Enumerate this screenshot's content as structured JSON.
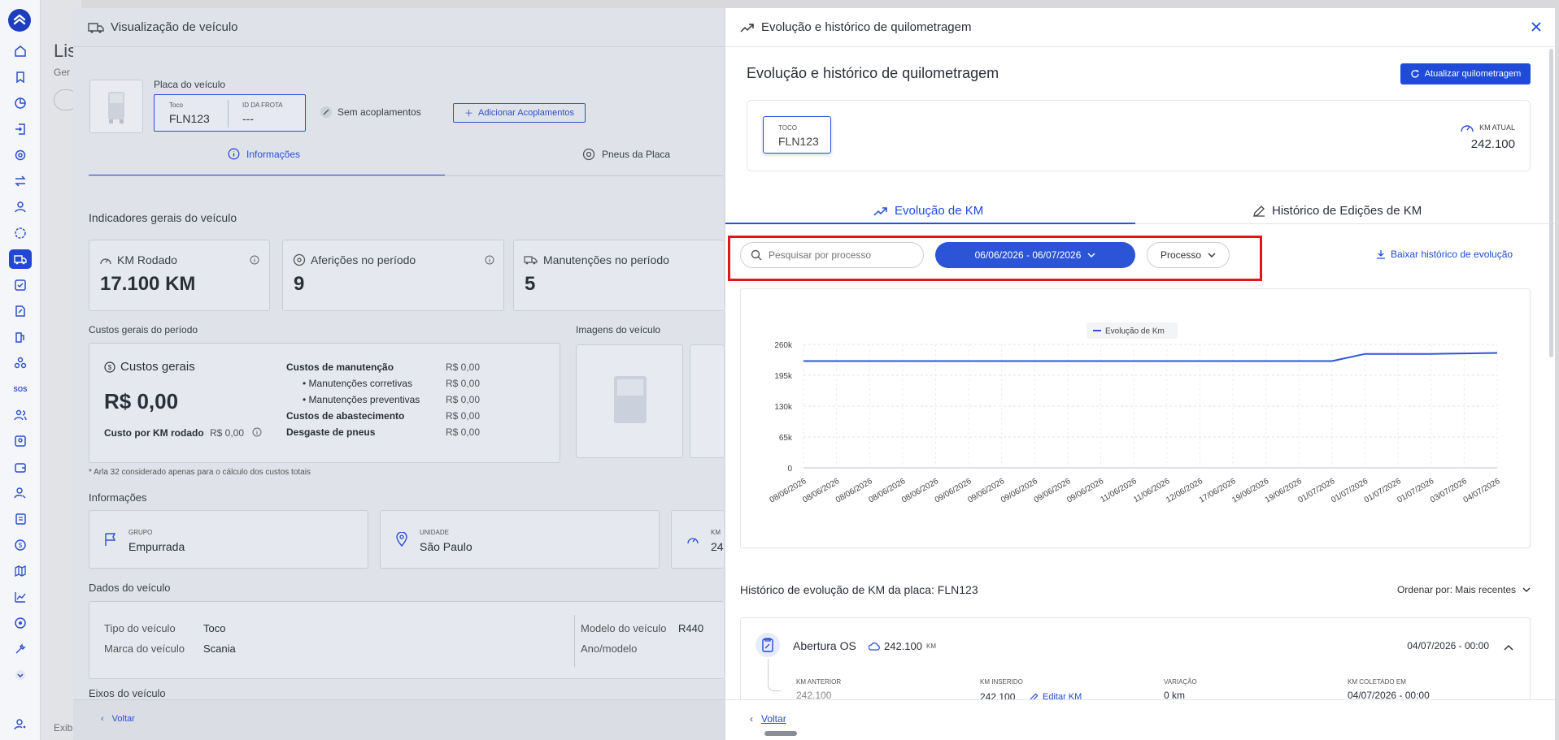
{
  "page_bg": {
    "title": "Lis",
    "subtitle": "Ger",
    "footer": "Exib"
  },
  "vehicle_panel": {
    "title": "Visualização de veículo",
    "plate_label": "Placa do veículo",
    "vehicle_type": "Toco",
    "plate": "FLN123",
    "fleet_id_label": "ID DA FROTA",
    "fleet_id": "---",
    "couplings_status": "Sem acoplamentos",
    "add_couplings": "Adicionar Acoplamentos",
    "tabs": [
      {
        "label": "Informações",
        "icon": "info-icon"
      },
      {
        "label": "Pneus da Placa",
        "icon": "tire-icon"
      }
    ],
    "indicators_title": "Indicadores gerais do veículo",
    "indicators": [
      {
        "label": "KM Rodado",
        "value": "17.100 KM"
      },
      {
        "label": "Aferições no período",
        "value": "9"
      },
      {
        "label": "Manutenções no período",
        "value": "5"
      }
    ],
    "costs_title": "Custos gerais do período",
    "costs": {
      "label": "Custos gerais",
      "total": "R$ 0,00",
      "per_km_label": "Custo por KM rodado",
      "per_km_value": "R$ 0,00",
      "rows": [
        {
          "label": "Custos de manutenção",
          "value": "R$ 0,00"
        },
        {
          "label": "Manutenções corretivas",
          "value": "R$ 0,00"
        },
        {
          "label": "Manutenções preventivas",
          "value": "R$ 0,00"
        },
        {
          "label": "Custos de abastecimento",
          "value": "R$ 0,00"
        },
        {
          "label": "Desgaste de pneus",
          "value": "R$ 0,00"
        }
      ],
      "note": "* Arla 32 considerado apenas para o cálculo dos custos totais"
    },
    "images_title": "Imagens do veículo",
    "info_title": "Informações",
    "info_cards": [
      {
        "label": "GRUPO",
        "value": "Empurrada"
      },
      {
        "label": "UNIDADE",
        "value": "São Paulo"
      },
      {
        "label": "KM",
        "value": "24"
      }
    ],
    "data_title": "Dados do veículo",
    "data_rows": [
      {
        "label": "Tipo do veículo",
        "value": "Toco"
      },
      {
        "label": "Marca do veículo",
        "value": "Scania"
      },
      {
        "label": "Modelo do veículo",
        "value": "R440"
      },
      {
        "label": "Ano/modelo",
        "value": ""
      }
    ],
    "axles_title": "Eixos do veículo",
    "back": "Voltar"
  },
  "km_panel": {
    "header_title": "Evolução e histórico de quilometragem",
    "section_title": "Evolução e histórico de quilometragem",
    "update_button": "Atualizar quilometragem",
    "vehicle_type": "TOCO",
    "plate": "FLN123",
    "km_current_label": "KM ATUAL",
    "km_current_value": "242.100",
    "tabs": [
      {
        "label": "Evolução de KM",
        "icon": "trend-up-icon",
        "active": true
      },
      {
        "label": "Histórico de Edições de KM",
        "icon": "pencil-icon",
        "active": false
      }
    ],
    "search_placeholder": "Pesquisar por processo",
    "date_range": "06/06/2026 - 06/07/2026",
    "process_filter": "Processo",
    "download_link": "Baixar histórico de evolução",
    "history_title": "Histórico de evolução de KM da placa: FLN123",
    "order_by": "Ordenar por: Mais recentes",
    "history_items": [
      {
        "process": "Abertura OS",
        "km": "242.100",
        "km_unit": "KM",
        "datetime": "04/07/2026 - 00:00",
        "prev_label": "KM ANTERIOR",
        "prev_value": "242.100",
        "inserted_label": "KM INSERIDO",
        "inserted_value": "242.100",
        "edit_label": "Editar KM",
        "variation_label": "VARIAÇÃO",
        "variation_value": "0 km",
        "collected_label": "KM COLETADO EM",
        "collected_value": "04/07/2026 - 00:00"
      }
    ],
    "back": "Voltar"
  },
  "chart_data": {
    "type": "line",
    "title": "",
    "xlabel": "",
    "ylabel": "",
    "legend_position": "top-center",
    "grid": true,
    "ylim": [
      0,
      260000
    ],
    "y_ticks": [
      "0",
      "65k",
      "130k",
      "195k",
      "260k"
    ],
    "categories": [
      "08/06/2026",
      "08/06/2026",
      "08/06/2026",
      "08/06/2026",
      "08/06/2026",
      "09/06/2026",
      "09/06/2026",
      "09/06/2026",
      "09/06/2026",
      "09/06/2026",
      "11/06/2026",
      "11/06/2026",
      "12/06/2026",
      "17/06/2026",
      "19/06/2026",
      "19/06/2026",
      "01/07/2026",
      "01/07/2026",
      "01/07/2026",
      "01/07/2026",
      "03/07/2026",
      "04/07/2026"
    ],
    "series": [
      {
        "name": "Evolução de Km",
        "color": "#2b55d6",
        "values": [
          225000,
          225000,
          225000,
          225000,
          225000,
          225000,
          225000,
          225000,
          225000,
          225000,
          225000,
          225000,
          225000,
          225000,
          225000,
          225000,
          225000,
          240000,
          240000,
          240000,
          241000,
          242100
        ]
      }
    ]
  },
  "colors": {
    "primary": "#1f4bd8",
    "highlight_box": "#e3141b",
    "overlay": "#dfe2e8"
  }
}
